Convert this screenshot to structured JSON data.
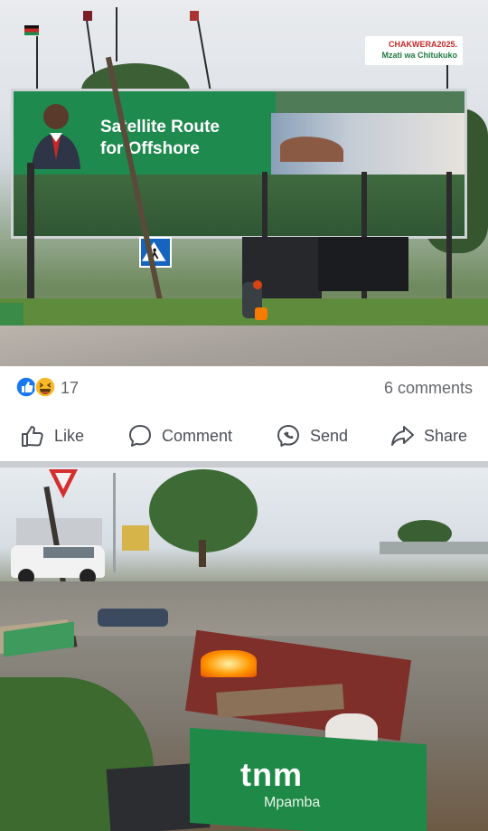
{
  "post": {
    "photo1": {
      "billboard_headline_line1": "Satellite Route",
      "billboard_headline_line2": "for Offshore",
      "campaign_line1": "CHAKWERA2025.",
      "campaign_line2": "Mzati wa Chitukuko"
    },
    "reactions": {
      "count": "17",
      "icons": [
        "like-reaction-icon",
        "haha-reaction-icon"
      ],
      "comments_label": "6 comments"
    },
    "actions": [
      {
        "label": "Like",
        "icon": "thumbs-up-icon"
      },
      {
        "label": "Comment",
        "icon": "speech-bubble-icon"
      },
      {
        "label": "Send",
        "icon": "messenger-icon"
      },
      {
        "label": "Share",
        "icon": "share-arrow-icon"
      }
    ],
    "photo2": {
      "sign_brand": "tnm",
      "sign_sub": "Mpamba"
    }
  },
  "colors": {
    "text_secondary": "#65676b",
    "action_text": "#4b4f56",
    "like_blue": "#1877f2",
    "haha_yellow": "#f7b928",
    "divider": "#c9ccd1",
    "billboard_green": "#1e8a4e"
  }
}
